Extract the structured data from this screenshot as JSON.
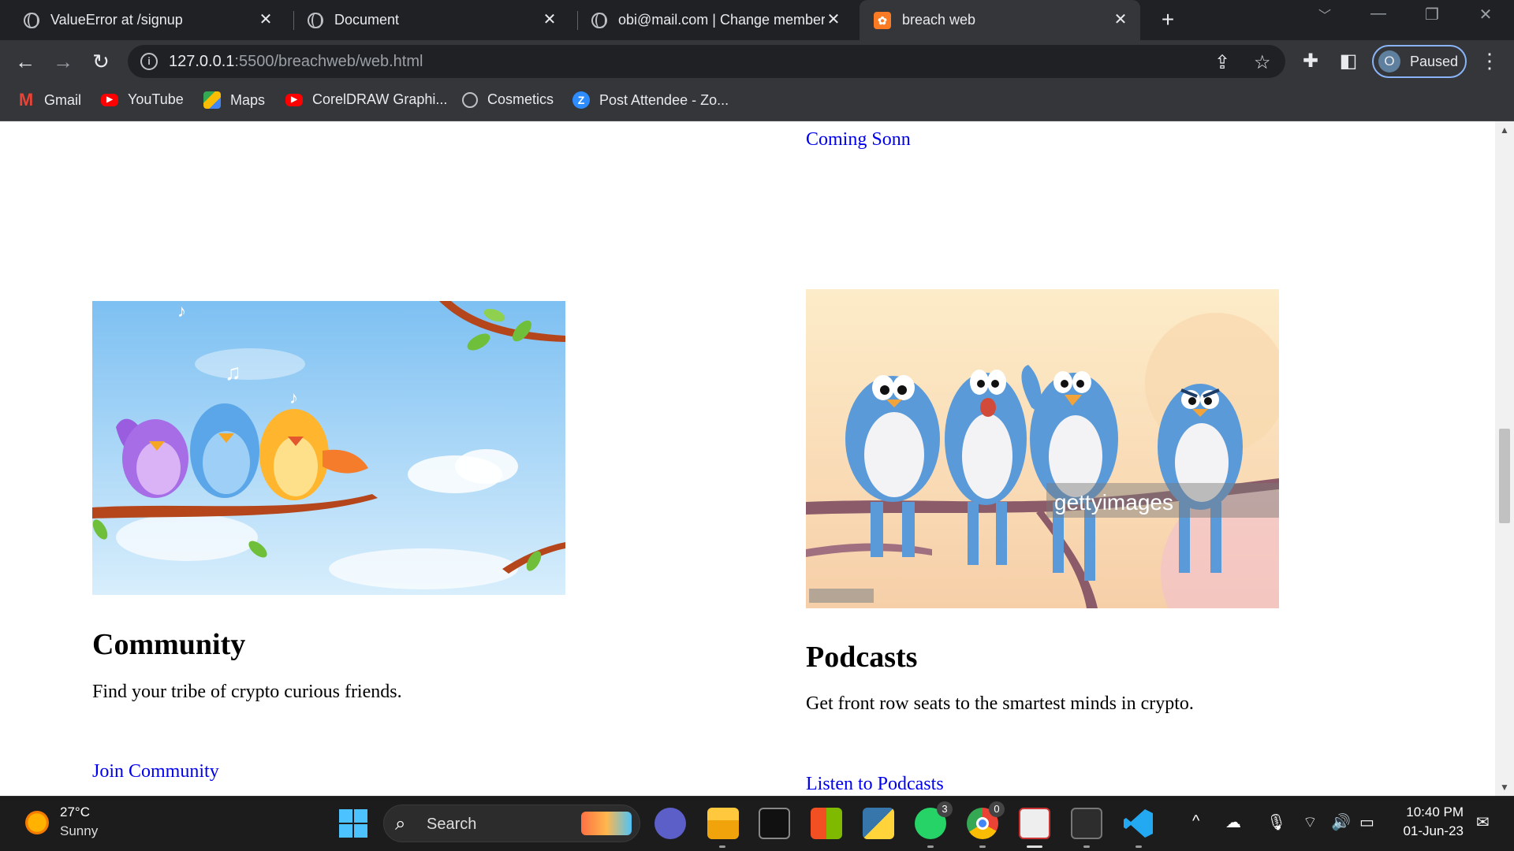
{
  "browser": {
    "tabs": [
      {
        "title": "ValueError at /signup",
        "favicon": "globe-icon",
        "close": "✕"
      },
      {
        "title": "Document",
        "favicon": "globe-icon",
        "close": "✕"
      },
      {
        "title": "obi@mail.com | Change member",
        "favicon": "globe-icon",
        "close": "✕"
      },
      {
        "title": "breach web",
        "favicon": "xampp-icon",
        "close": "✕",
        "active": true
      }
    ],
    "new_tab": "+",
    "url_host": "127.0.0.1",
    "url_path": ":5500/breachweb/web.html",
    "profile_initial": "O",
    "profile_label": "Paused",
    "bookmarks": [
      {
        "label": "Gmail",
        "icon": "gmail-icon"
      },
      {
        "label": "YouTube",
        "icon": "youtube-icon"
      },
      {
        "label": "Maps",
        "icon": "maps-icon"
      },
      {
        "label": "CorelDRAW Graphi...",
        "icon": "youtube-icon"
      },
      {
        "label": "Cosmetics",
        "icon": "globe-icon"
      },
      {
        "label": "Post Attendee - Zo...",
        "icon": "zoom-icon"
      }
    ]
  },
  "page": {
    "top_right_link": "Coming Sonn",
    "community": {
      "title": "Community",
      "text": "Find your tribe of crypto curious friends.",
      "link": "Join Community"
    },
    "podcasts": {
      "title": "Podcasts",
      "text": "Get front row seats to the smartest minds in crypto.",
      "link": "Listen to Podcasts",
      "watermark": "gettyimages"
    }
  },
  "taskbar": {
    "temp": "27°C",
    "condition": "Sunny",
    "search_label": "Search",
    "whatsapp_badge": "3",
    "chrome_badge": "0",
    "time": "10:40 PM",
    "date": "01-Jun-23"
  }
}
